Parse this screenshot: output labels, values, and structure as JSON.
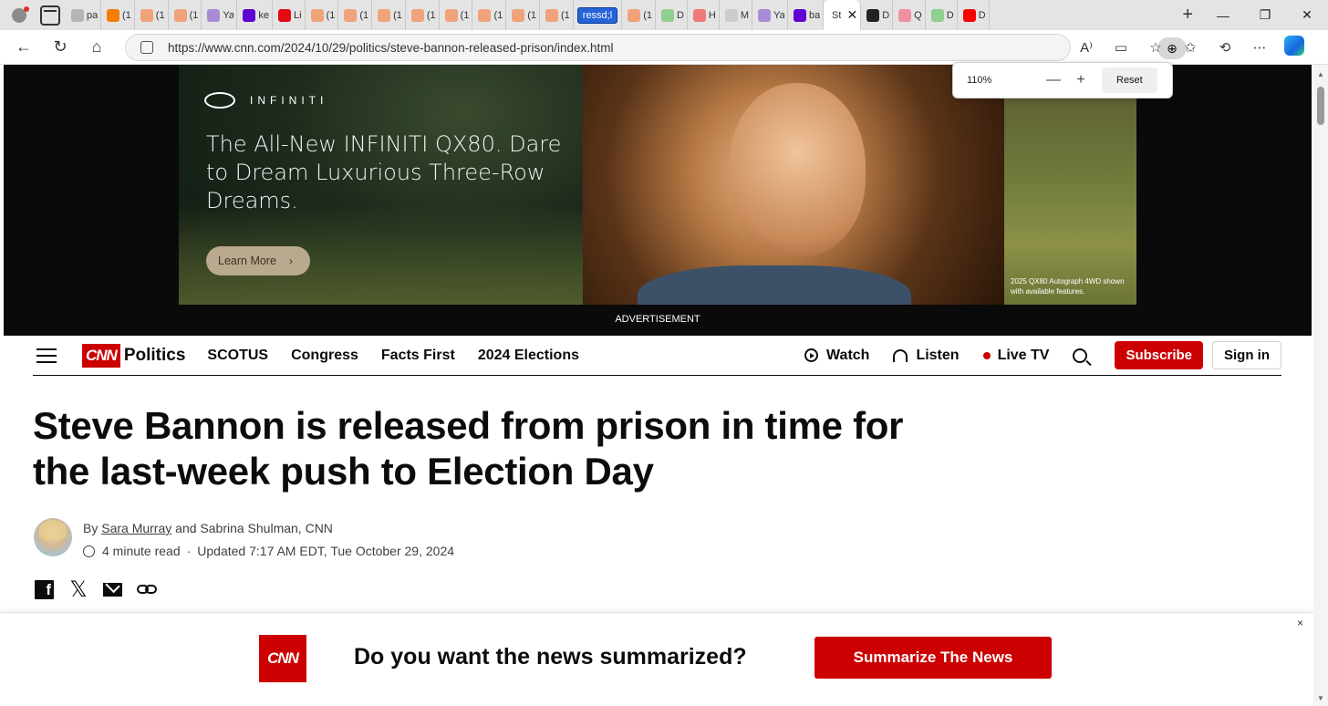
{
  "browser": {
    "tabs": [
      {
        "icon": "page-icon",
        "label": "pa",
        "color": "#b5b5b5"
      },
      {
        "icon": "blogger-icon",
        "label": "(1",
        "color": "#f57d00"
      },
      {
        "icon": "substack-icon",
        "label": "(1",
        "color": "#f0a27a"
      },
      {
        "icon": "substack-icon",
        "label": "(1",
        "color": "#f0a27a"
      },
      {
        "icon": "yahoo-icon",
        "label": "Ya",
        "color": "#a98bd6"
      },
      {
        "icon": "yahoo-icon",
        "label": "ke",
        "color": "#6001d2"
      },
      {
        "icon": "netflix-icon",
        "label": "Li",
        "color": "#e50914"
      },
      {
        "icon": "substack-icon",
        "label": "(1",
        "color": "#f0a27a"
      },
      {
        "icon": "substack-icon",
        "label": "(1",
        "color": "#f0a27a"
      },
      {
        "icon": "substack-icon",
        "label": "(1",
        "color": "#f0a27a"
      },
      {
        "icon": "substack-icon",
        "label": "(1",
        "color": "#f0a27a"
      },
      {
        "icon": "substack-icon",
        "label": "(1",
        "color": "#f0a27a"
      },
      {
        "icon": "substack-icon",
        "label": "(1",
        "color": "#f0a27a"
      },
      {
        "icon": "substack-icon",
        "label": "(1",
        "color": "#f0a27a"
      },
      {
        "icon": "substack-icon",
        "label": "(1",
        "color": "#f0a27a"
      }
    ],
    "rename_tab": "ressd;l",
    "tabs_after": [
      {
        "icon": "substack-icon",
        "label": "(1",
        "color": "#f0a27a"
      },
      {
        "icon": "play-icon",
        "label": "D",
        "color": "#8fd08f"
      },
      {
        "icon": "mic-icon",
        "label": "H",
        "color": "#f07a7a"
      },
      {
        "icon": "search-icon",
        "label": "M",
        "color": "#cccccc"
      },
      {
        "icon": "yahoo-icon",
        "label": "Ya",
        "color": "#a98bd6"
      },
      {
        "icon": "yahoo-icon",
        "label": "ba",
        "color": "#6001d2"
      }
    ],
    "active_tab": {
      "label": "St",
      "close": "✕"
    },
    "tabs_end": [
      {
        "icon": "cnn-icon",
        "label": "D",
        "color": "#222222"
      },
      {
        "icon": "youtube-icon",
        "label": "Q",
        "color": "#f08fa0"
      },
      {
        "icon": "play-icon",
        "label": "D",
        "color": "#8fd08f"
      },
      {
        "icon": "youtube-icon",
        "label": "D",
        "color": "#ff0000"
      }
    ],
    "newtab": "+",
    "window_controls": {
      "minimize": "—",
      "restore": "❐",
      "close": "✕"
    },
    "url": "https://www.cnn.com/2024/10/29/politics/steve-bannon-released-prison/index.html",
    "zoom": {
      "value": "110%",
      "minus": "—",
      "plus": "+",
      "reset": "Reset"
    }
  },
  "ad": {
    "brand": "INFINITI",
    "headline": "The All-New INFINITI QX80. Dare to Dream Luxurious Three-Row Dreams.",
    "button": "Learn More",
    "chevron": "›",
    "fineprint": "2025 QX80 Autograph 4WD shown with available features.",
    "label": "ADVERTISEMENT"
  },
  "nav": {
    "logo": "CNN",
    "section": "Politics",
    "links": [
      "SCOTUS",
      "Congress",
      "Facts First",
      "2024 Elections"
    ],
    "watch": "Watch",
    "listen": "Listen",
    "live": "Live TV",
    "subscribe": "Subscribe",
    "signin": "Sign in"
  },
  "article": {
    "headline": "Steve Bannon is released from prison in time for the last-week push to Election Day",
    "by": "By",
    "author1": "Sara Murray",
    "author_rest": "and Sabrina Shulman, CNN",
    "read_time": "4 minute read",
    "separator": "·",
    "updated": "Updated 7:17 AM EDT, Tue October 29, 2024"
  },
  "share": {
    "facebook": "f",
    "x": "𝕏"
  },
  "promo": {
    "logo": "CNN",
    "text": "Do you want the news summarized?",
    "button": "Summarize The News",
    "close": "×"
  },
  "colors": {
    "cnn_red": "#cc0000",
    "ink": "#0c0c0c",
    "ad_bg": "#0a0a0a"
  }
}
